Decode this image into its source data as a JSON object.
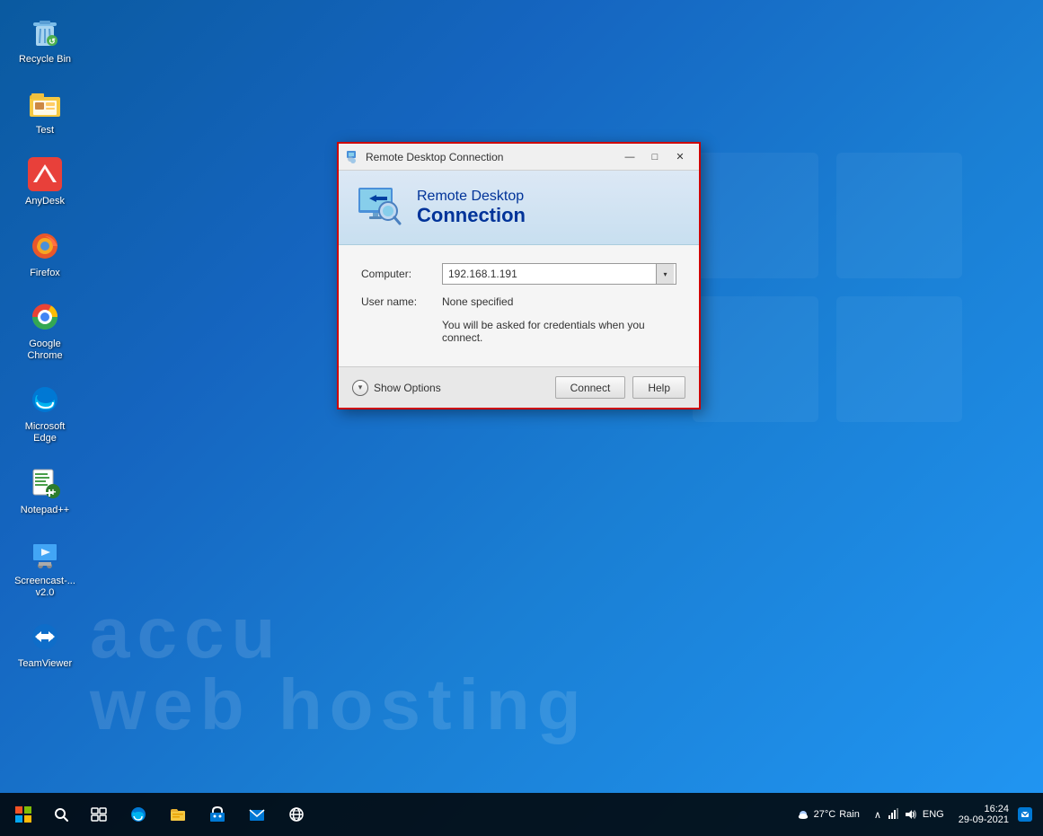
{
  "desktop": {
    "watermark1": "accu",
    "watermark2": "web hosting"
  },
  "desktop_icons": [
    {
      "id": "recycle-bin",
      "label": "Recycle Bin",
      "icon": "recycle"
    },
    {
      "id": "test-folder",
      "label": "Test",
      "icon": "folder"
    },
    {
      "id": "anydesk",
      "label": "AnyDesk",
      "icon": "anydesk"
    },
    {
      "id": "firefox",
      "label": "Firefox",
      "icon": "firefox"
    },
    {
      "id": "google-chrome",
      "label": "Google Chrome",
      "icon": "chrome"
    },
    {
      "id": "microsoft-edge",
      "label": "Microsoft Edge",
      "icon": "edge"
    },
    {
      "id": "notepadpp",
      "label": "Notepad++",
      "icon": "notepad"
    },
    {
      "id": "screencast",
      "label": "Screencast-... v2.0",
      "icon": "screencast"
    },
    {
      "id": "teamviewer",
      "label": "TeamViewer",
      "icon": "teamviewer"
    }
  ],
  "rdp_dialog": {
    "title": "Remote Desktop Connection",
    "header_line1": "Remote Desktop",
    "header_line2": "Connection",
    "computer_label": "Computer:",
    "computer_value": "192.168.1.191",
    "username_label": "User name:",
    "username_value": "None specified",
    "info_text": "You will be asked for credentials when you connect.",
    "show_options_label": "Show Options",
    "connect_label": "Connect",
    "help_label": "Help",
    "min_label": "—",
    "max_label": "□",
    "close_label": "✕"
  },
  "taskbar": {
    "weather_temp": "27°C",
    "weather_desc": "Rain",
    "language": "ENG",
    "time": "16:24",
    "date": "29-09-2021"
  }
}
